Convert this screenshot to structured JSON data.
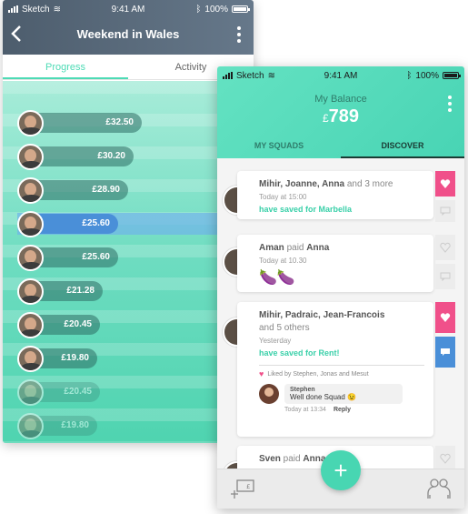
{
  "back_phone": {
    "status": {
      "carrier": "Sketch",
      "time": "9:41 AM",
      "battery": "100%"
    },
    "title": "Weekend in Wales",
    "tabs": [
      {
        "label": "Progress",
        "active": true
      },
      {
        "label": "Activity",
        "active": false
      }
    ],
    "progress": [
      {
        "amount": "£32.50",
        "fraction": 1.0
      },
      {
        "amount": "£30.20",
        "fraction": 0.93
      },
      {
        "amount": "£28.90",
        "fraction": 0.88
      },
      {
        "amount": "£25.60",
        "fraction": 0.79,
        "highlighted": true
      },
      {
        "amount": "£25.60",
        "fraction": 0.79
      },
      {
        "amount": "£21.28",
        "fraction": 0.66
      },
      {
        "amount": "£20.45",
        "fraction": 0.63
      },
      {
        "amount": "£19.80",
        "fraction": 0.61
      },
      {
        "amount": "£20.45",
        "fraction": 0.63
      },
      {
        "amount": "£19.80",
        "fraction": 0.61
      }
    ]
  },
  "front_phone": {
    "status": {
      "carrier": "Sketch",
      "time": "9:41 AM",
      "battery": "100%"
    },
    "balance_label": "My Balance",
    "balance_currency": "£",
    "balance_value": "789",
    "tabs": [
      {
        "label": "MY SQUADS",
        "active": false
      },
      {
        "label": "DISCOVER",
        "active": true
      }
    ],
    "feed": [
      {
        "names": "Mihir, Joanne, Anna",
        "names_suffix": " and 3 more",
        "time": "Today at 15:00",
        "message": "have saved for Marbella"
      },
      {
        "names": "Aman",
        "names_suffix": " paid ",
        "names_target": "Anna",
        "time": "Today at 10.30",
        "emoji": "🍆🍆"
      },
      {
        "names": "Mihir, Padraic, Jean-Francois",
        "names_suffix": "and 5 others",
        "time": "Yesterday",
        "message": "have saved for Rent!",
        "likes": "Liked by Stephen, Jonas and Mesut",
        "comment": {
          "author": "Stephen",
          "text": "Well done Squad 😉",
          "time": "Today at 13:34",
          "reply": "Reply"
        }
      },
      {
        "names": "Sven",
        "names_suffix": " paid ",
        "names_target": "Anna"
      }
    ]
  },
  "colors": {
    "accent": "#48d6b2",
    "pink": "#f0508a",
    "blue": "#4a8fd8",
    "dark": "#3f4c5c"
  },
  "icons": [
    "back-chevron-icon",
    "kebab-menu-icon",
    "add-money-icon",
    "gift-icon",
    "comment-icon",
    "heart-icon",
    "plus-icon",
    "group-icon"
  ]
}
